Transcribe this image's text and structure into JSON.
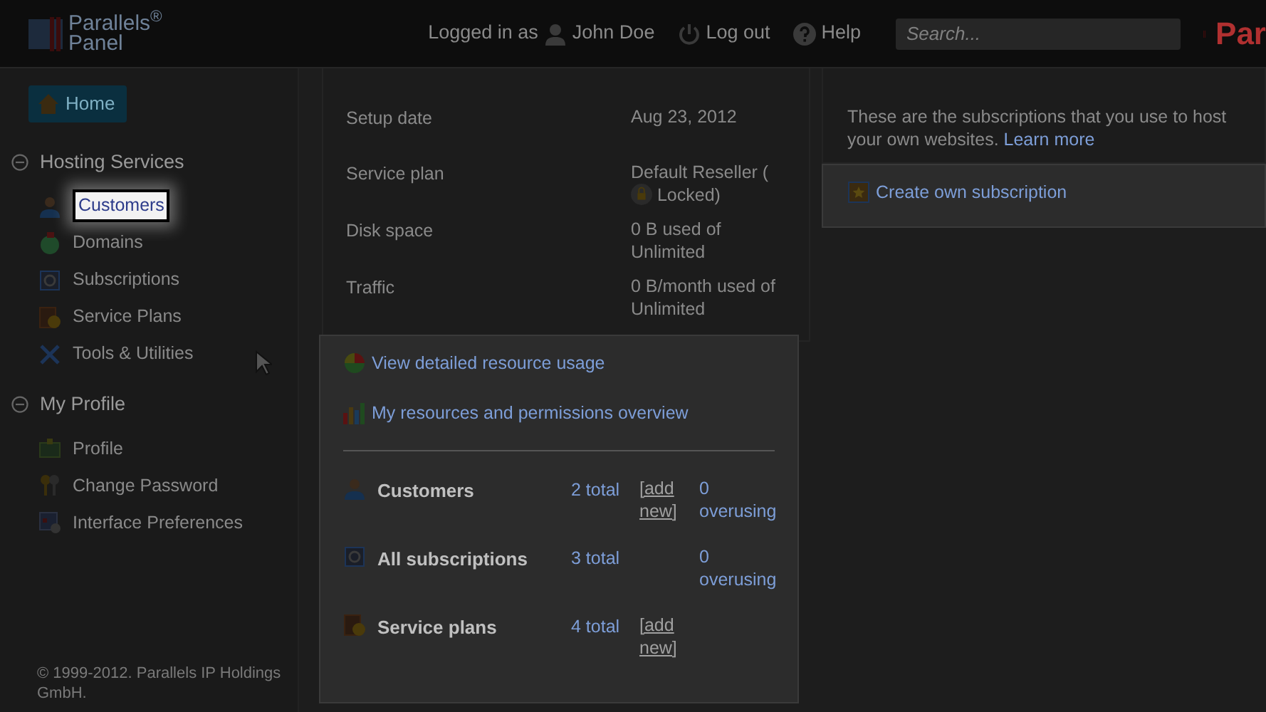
{
  "header": {
    "logo_lines": [
      "Parallels$^{®}$",
      "Panel"
    ],
    "logged_in_label": "Logged in as",
    "user": "John Doe",
    "logout": "Log out",
    "help": "Help",
    "search": {
      "placeholder": "Search..."
    },
    "brand_cut": "Par"
  },
  "sidebar": {
    "home": "Home",
    "sections": [
      {
        "title": "Hosting Services",
        "expanded": true,
        "items": [
          {
            "label": "Customers",
            "kind": "person",
            "highlighted": true
          },
          {
            "label": "Domains",
            "kind": "globe",
            "highlighted": false
          },
          {
            "label": "Subscriptions",
            "kind": "gear",
            "highlighted": false
          },
          {
            "label": "Service Plans",
            "kind": "plan",
            "highlighted": false
          },
          {
            "label": "Tools & Utilities",
            "kind": "tools",
            "highlighted": false
          }
        ]
      },
      {
        "title": "My Profile",
        "expanded": true,
        "items": [
          {
            "label": "Profile",
            "kind": "card",
            "highlighted": false
          },
          {
            "label": "Change Password",
            "kind": "keys",
            "highlighted": false
          },
          {
            "label": "Interface Preferences",
            "kind": "prefs",
            "highlighted": false
          }
        ]
      }
    ],
    "footer": "© 1999-2012. Parallels IP Holdings GmbH."
  },
  "account_info": [
    {
      "label": "Setup date",
      "value": "Aug 23, 2012"
    },
    {
      "label": "Service plan",
      "value": "Default Reseller (",
      "locked_text": "Locked)"
    },
    {
      "label": "Disk space",
      "value": "0 B used of Unlimited"
    },
    {
      "label": "Traffic",
      "value": "0 B/month used of Unlimited"
    }
  ],
  "resource_links": [
    {
      "label": "View detailed resource usage",
      "kind": "pie"
    },
    {
      "label": "My resources and permissions overview",
      "kind": "bars"
    }
  ],
  "stats": [
    {
      "label": "Customers",
      "kind": "person",
      "total": "2 total",
      "add_new": "[add new]",
      "overusing": "0 overusing"
    },
    {
      "label": "All subscriptions",
      "kind": "gear",
      "total": "3 total",
      "overusing": "0 overusing"
    },
    {
      "label": "Service plans",
      "kind": "plan",
      "total": "4 total",
      "add_new": "[add new]"
    }
  ],
  "own_subscriptions": {
    "text": "These are the subscriptions that you use to host your own websites.",
    "link": "Learn more",
    "action": "Create own subscription"
  }
}
